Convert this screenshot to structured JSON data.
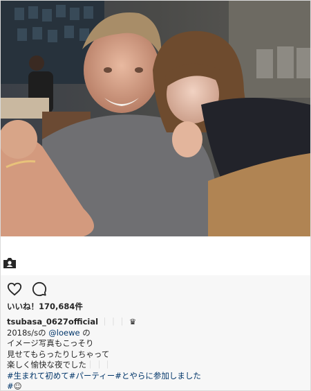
{
  "post": {
    "likes_label": "いいね！",
    "likes_count": "170,684件",
    "username": "tsubasa_0627official",
    "username_suffix": "｜｜｜",
    "username_emoji": "♛",
    "caption_lines": [
      {
        "pre": "2018s/sの ",
        "mention": "@loewe",
        "post": " の"
      },
      {
        "text": "イメージ写真もこっそり"
      },
      {
        "text": "見せてもらったりしちゃって"
      },
      {
        "text": "楽しく愉快な夜でした",
        "suffix": "｜｜｜"
      }
    ],
    "hashtag_line": "#生まれて初めて#パーティー#とやらに参加しました",
    "hashtag_last": "#",
    "hashtag_last_emoji": "☺"
  },
  "icons": {
    "tag": "person-tag-icon",
    "like": "heart-icon",
    "comment": "comment-bubble-icon"
  },
  "colors": {
    "link": "#003569",
    "action_bar_bg": "#f7f7f7",
    "border": "#dbdbdb"
  }
}
